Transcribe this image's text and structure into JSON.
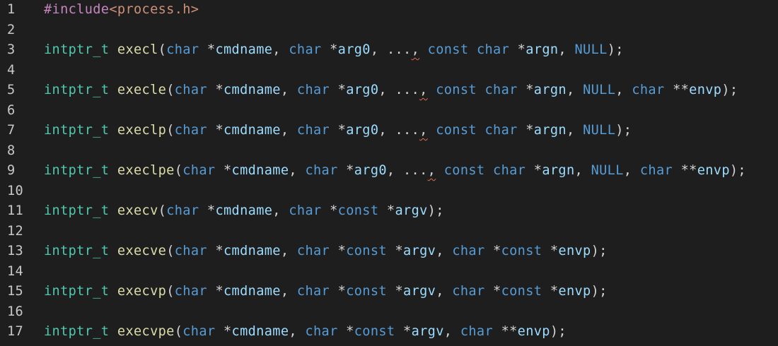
{
  "colors": {
    "background": "#1e1e1e",
    "line_number": "#c8c8c8",
    "type": "#4ec9b0",
    "function": "#dcdcaa",
    "keyword": "#569cd6",
    "variable": "#9cdcfe",
    "preprocessor": "#c586c0",
    "string": "#ce9178",
    "punctuation": "#d4d4d4",
    "squiggle": "#e06c4a"
  },
  "lines": [
    {
      "n": "1",
      "tokens": [
        {
          "t": "#include",
          "c": "pre"
        },
        {
          "t": "<process.h>",
          "c": "str"
        }
      ]
    },
    {
      "n": "2",
      "tokens": []
    },
    {
      "n": "3",
      "tokens": [
        {
          "t": "intptr_t",
          "c": "type"
        },
        {
          "t": " ",
          "c": "punc"
        },
        {
          "t": "execl",
          "c": "func"
        },
        {
          "t": "(",
          "c": "punc"
        },
        {
          "t": "char",
          "c": "kw"
        },
        {
          "t": " *",
          "c": "punc"
        },
        {
          "t": "cmdname",
          "c": "var"
        },
        {
          "t": ", ",
          "c": "punc"
        },
        {
          "t": "char",
          "c": "kw"
        },
        {
          "t": " *",
          "c": "punc"
        },
        {
          "t": "arg0",
          "c": "var"
        },
        {
          "t": ", ",
          "c": "punc"
        },
        {
          "t": "...",
          "c": "punc"
        },
        {
          "t": ",",
          "c": "punc",
          "s": true
        },
        {
          "t": " ",
          "c": "punc"
        },
        {
          "t": "const",
          "c": "kw"
        },
        {
          "t": " ",
          "c": "punc"
        },
        {
          "t": "char",
          "c": "kw"
        },
        {
          "t": " *",
          "c": "punc"
        },
        {
          "t": "argn",
          "c": "var"
        },
        {
          "t": ", ",
          "c": "punc"
        },
        {
          "t": "NULL",
          "c": "kw"
        },
        {
          "t": ");",
          "c": "punc"
        }
      ]
    },
    {
      "n": "4",
      "tokens": []
    },
    {
      "n": "5",
      "tokens": [
        {
          "t": "intptr_t",
          "c": "type"
        },
        {
          "t": " ",
          "c": "punc"
        },
        {
          "t": "execle",
          "c": "func"
        },
        {
          "t": "(",
          "c": "punc"
        },
        {
          "t": "char",
          "c": "kw"
        },
        {
          "t": " *",
          "c": "punc"
        },
        {
          "t": "cmdname",
          "c": "var"
        },
        {
          "t": ", ",
          "c": "punc"
        },
        {
          "t": "char",
          "c": "kw"
        },
        {
          "t": " *",
          "c": "punc"
        },
        {
          "t": "arg0",
          "c": "var"
        },
        {
          "t": ", ",
          "c": "punc"
        },
        {
          "t": "...",
          "c": "punc"
        },
        {
          "t": ",",
          "c": "punc",
          "s": true
        },
        {
          "t": " ",
          "c": "punc"
        },
        {
          "t": "const",
          "c": "kw"
        },
        {
          "t": " ",
          "c": "punc"
        },
        {
          "t": "char",
          "c": "kw"
        },
        {
          "t": " *",
          "c": "punc"
        },
        {
          "t": "argn",
          "c": "var"
        },
        {
          "t": ", ",
          "c": "punc"
        },
        {
          "t": "NULL",
          "c": "kw"
        },
        {
          "t": ", ",
          "c": "punc"
        },
        {
          "t": "char",
          "c": "kw"
        },
        {
          "t": " **",
          "c": "punc"
        },
        {
          "t": "envp",
          "c": "var"
        },
        {
          "t": ");",
          "c": "punc"
        }
      ]
    },
    {
      "n": "6",
      "tokens": []
    },
    {
      "n": "7",
      "tokens": [
        {
          "t": "intptr_t",
          "c": "type"
        },
        {
          "t": " ",
          "c": "punc"
        },
        {
          "t": "execlp",
          "c": "func"
        },
        {
          "t": "(",
          "c": "punc"
        },
        {
          "t": "char",
          "c": "kw"
        },
        {
          "t": " *",
          "c": "punc"
        },
        {
          "t": "cmdname",
          "c": "var"
        },
        {
          "t": ", ",
          "c": "punc"
        },
        {
          "t": "char",
          "c": "kw"
        },
        {
          "t": " *",
          "c": "punc"
        },
        {
          "t": "arg0",
          "c": "var"
        },
        {
          "t": ", ",
          "c": "punc"
        },
        {
          "t": "...",
          "c": "punc"
        },
        {
          "t": ",",
          "c": "punc",
          "s": true
        },
        {
          "t": " ",
          "c": "punc"
        },
        {
          "t": "const",
          "c": "kw"
        },
        {
          "t": " ",
          "c": "punc"
        },
        {
          "t": "char",
          "c": "kw"
        },
        {
          "t": " *",
          "c": "punc"
        },
        {
          "t": "argn",
          "c": "var"
        },
        {
          "t": ", ",
          "c": "punc"
        },
        {
          "t": "NULL",
          "c": "kw"
        },
        {
          "t": ");",
          "c": "punc"
        }
      ]
    },
    {
      "n": "8",
      "tokens": []
    },
    {
      "n": "9",
      "tokens": [
        {
          "t": "intptr_t",
          "c": "type"
        },
        {
          "t": " ",
          "c": "punc"
        },
        {
          "t": "execlpe",
          "c": "func"
        },
        {
          "t": "(",
          "c": "punc"
        },
        {
          "t": "char",
          "c": "kw"
        },
        {
          "t": " *",
          "c": "punc"
        },
        {
          "t": "cmdname",
          "c": "var"
        },
        {
          "t": ", ",
          "c": "punc"
        },
        {
          "t": "char",
          "c": "kw"
        },
        {
          "t": " *",
          "c": "punc"
        },
        {
          "t": "arg0",
          "c": "var"
        },
        {
          "t": ", ",
          "c": "punc"
        },
        {
          "t": "...",
          "c": "punc"
        },
        {
          "t": ",",
          "c": "punc",
          "s": true
        },
        {
          "t": " ",
          "c": "punc"
        },
        {
          "t": "const",
          "c": "kw"
        },
        {
          "t": " ",
          "c": "punc"
        },
        {
          "t": "char",
          "c": "kw"
        },
        {
          "t": " *",
          "c": "punc"
        },
        {
          "t": "argn",
          "c": "var"
        },
        {
          "t": ", ",
          "c": "punc"
        },
        {
          "t": "NULL",
          "c": "kw"
        },
        {
          "t": ", ",
          "c": "punc"
        },
        {
          "t": "char",
          "c": "kw"
        },
        {
          "t": " **",
          "c": "punc"
        },
        {
          "t": "envp",
          "c": "var"
        },
        {
          "t": ");",
          "c": "punc"
        }
      ]
    },
    {
      "n": "10",
      "tokens": []
    },
    {
      "n": "11",
      "tokens": [
        {
          "t": "intptr_t",
          "c": "type"
        },
        {
          "t": " ",
          "c": "punc"
        },
        {
          "t": "execv",
          "c": "func"
        },
        {
          "t": "(",
          "c": "punc"
        },
        {
          "t": "char",
          "c": "kw"
        },
        {
          "t": " *",
          "c": "punc"
        },
        {
          "t": "cmdname",
          "c": "var"
        },
        {
          "t": ", ",
          "c": "punc"
        },
        {
          "t": "char",
          "c": "kw"
        },
        {
          "t": " *",
          "c": "punc"
        },
        {
          "t": "const",
          "c": "kw"
        },
        {
          "t": " *",
          "c": "punc"
        },
        {
          "t": "argv",
          "c": "var"
        },
        {
          "t": ");",
          "c": "punc"
        }
      ]
    },
    {
      "n": "12",
      "tokens": []
    },
    {
      "n": "13",
      "tokens": [
        {
          "t": "intptr_t",
          "c": "type"
        },
        {
          "t": " ",
          "c": "punc"
        },
        {
          "t": "execve",
          "c": "func"
        },
        {
          "t": "(",
          "c": "punc"
        },
        {
          "t": "char",
          "c": "kw"
        },
        {
          "t": " *",
          "c": "punc"
        },
        {
          "t": "cmdname",
          "c": "var"
        },
        {
          "t": ", ",
          "c": "punc"
        },
        {
          "t": "char",
          "c": "kw"
        },
        {
          "t": " *",
          "c": "punc"
        },
        {
          "t": "const",
          "c": "kw"
        },
        {
          "t": " *",
          "c": "punc"
        },
        {
          "t": "argv",
          "c": "var"
        },
        {
          "t": ", ",
          "c": "punc"
        },
        {
          "t": "char",
          "c": "kw"
        },
        {
          "t": " *",
          "c": "punc"
        },
        {
          "t": "const",
          "c": "kw"
        },
        {
          "t": " *",
          "c": "punc"
        },
        {
          "t": "envp",
          "c": "var"
        },
        {
          "t": ");",
          "c": "punc"
        }
      ]
    },
    {
      "n": "14",
      "tokens": []
    },
    {
      "n": "15",
      "tokens": [
        {
          "t": "intptr_t",
          "c": "type"
        },
        {
          "t": " ",
          "c": "punc"
        },
        {
          "t": "execvp",
          "c": "func"
        },
        {
          "t": "(",
          "c": "punc"
        },
        {
          "t": "char",
          "c": "kw"
        },
        {
          "t": " *",
          "c": "punc"
        },
        {
          "t": "cmdname",
          "c": "var"
        },
        {
          "t": ", ",
          "c": "punc"
        },
        {
          "t": "char",
          "c": "kw"
        },
        {
          "t": " *",
          "c": "punc"
        },
        {
          "t": "const",
          "c": "kw"
        },
        {
          "t": " *",
          "c": "punc"
        },
        {
          "t": "argv",
          "c": "var"
        },
        {
          "t": ", ",
          "c": "punc"
        },
        {
          "t": "char",
          "c": "kw"
        },
        {
          "t": " *",
          "c": "punc"
        },
        {
          "t": "const",
          "c": "kw"
        },
        {
          "t": " *",
          "c": "punc"
        },
        {
          "t": "envp",
          "c": "var"
        },
        {
          "t": ");",
          "c": "punc"
        }
      ]
    },
    {
      "n": "16",
      "tokens": []
    },
    {
      "n": "17",
      "tokens": [
        {
          "t": "intptr_t",
          "c": "type"
        },
        {
          "t": " ",
          "c": "punc"
        },
        {
          "t": "execvpe",
          "c": "func"
        },
        {
          "t": "(",
          "c": "punc"
        },
        {
          "t": "char",
          "c": "kw"
        },
        {
          "t": " *",
          "c": "punc"
        },
        {
          "t": "cmdname",
          "c": "var"
        },
        {
          "t": ", ",
          "c": "punc"
        },
        {
          "t": "char",
          "c": "kw"
        },
        {
          "t": " *",
          "c": "punc"
        },
        {
          "t": "const",
          "c": "kw"
        },
        {
          "t": " *",
          "c": "punc"
        },
        {
          "t": "argv",
          "c": "var"
        },
        {
          "t": ", ",
          "c": "punc"
        },
        {
          "t": "char",
          "c": "kw"
        },
        {
          "t": " **",
          "c": "punc"
        },
        {
          "t": "envp",
          "c": "var"
        },
        {
          "t": ");",
          "c": "punc"
        }
      ]
    }
  ]
}
